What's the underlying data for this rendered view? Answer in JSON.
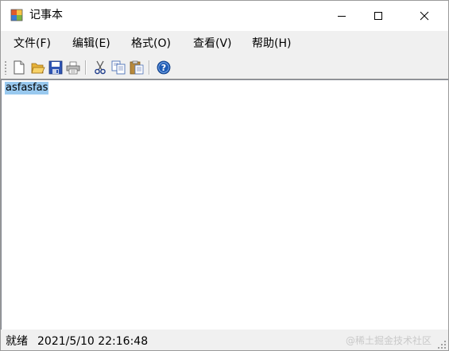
{
  "window": {
    "title": "记事本",
    "icon": "notepad-app-icon",
    "controls": [
      "minimize-icon",
      "maximize-icon",
      "close-icon"
    ]
  },
  "menu": {
    "file": "文件(F)",
    "edit": "编辑(E)",
    "format": "格式(O)",
    "view": "查看(V)",
    "help": "帮助(H)"
  },
  "toolbar": {
    "icons": [
      "new-file-icon",
      "open-folder-icon",
      "save-icon",
      "print-icon",
      "cut-icon",
      "copy-icon",
      "paste-icon",
      "help-icon"
    ]
  },
  "editor": {
    "content": "asfasfas",
    "selected": true
  },
  "status": {
    "ready": "就绪",
    "datetime": "2021/5/10 22:16:48"
  },
  "watermark": "@稀土掘金技术社区",
  "colors": {
    "selection": "#99c9ef",
    "chrome": "#f0f0f0",
    "help_blue": "#1e5bb5"
  }
}
